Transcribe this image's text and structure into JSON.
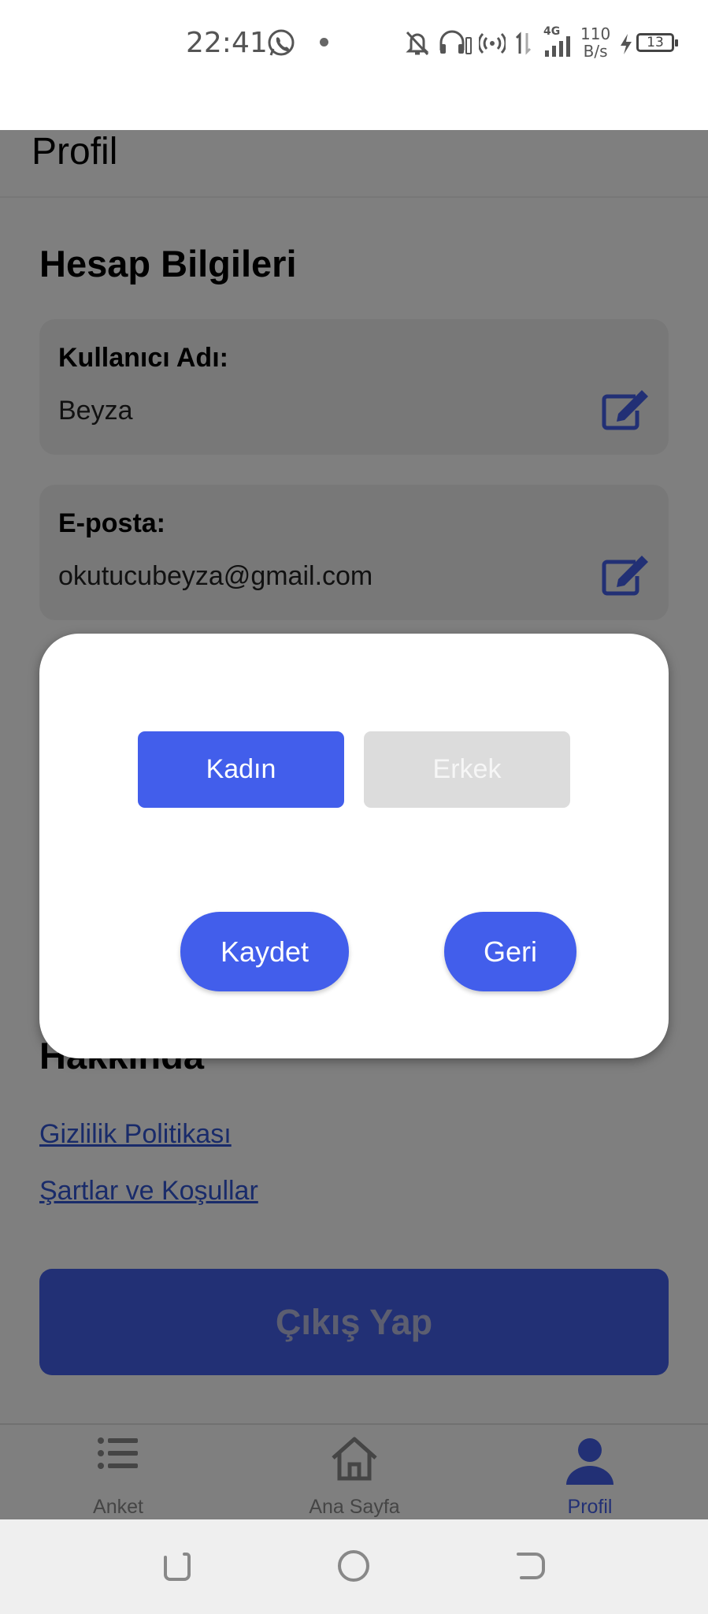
{
  "status_bar": {
    "time": "22:41",
    "network_type": "4G",
    "speed_value": "110",
    "speed_unit": "B/s",
    "battery": "13",
    "icons": [
      "whatsapp-icon",
      "notification-dot",
      "bell-off-icon",
      "headphones-icon",
      "hotspot-icon",
      "data-arrows-icon",
      "signal-icon",
      "charging-icon",
      "battery-icon"
    ]
  },
  "header": {
    "title": "Profil"
  },
  "account": {
    "title": "Hesap Bilgileri",
    "fields": [
      {
        "label": "Kullanıcı Adı:",
        "value": "Beyza",
        "icon": "edit-icon"
      },
      {
        "label": "E-posta:",
        "value": "okutucubeyza@gmail.com",
        "icon": "edit-icon"
      }
    ]
  },
  "about": {
    "title": "Hakkında",
    "links": [
      "Gizlilik Politikası",
      "Şartlar ve Koşullar"
    ]
  },
  "logout_label": "Çıkış Yap",
  "tabs": [
    {
      "label": "Anket",
      "icon": "list-icon",
      "active": false
    },
    {
      "label": "Ana Sayfa",
      "icon": "home-icon",
      "active": false
    },
    {
      "label": "Profil",
      "icon": "user-icon",
      "active": true
    }
  ],
  "modal": {
    "options": [
      {
        "label": "Kadın",
        "selected": true
      },
      {
        "label": "Erkek",
        "selected": false
      }
    ],
    "save_label": "Kaydet",
    "back_label": "Geri"
  },
  "system_nav": [
    "recents-icon",
    "home-circle-icon",
    "back-icon"
  ],
  "colors": {
    "accent": "#425EEB",
    "link": "#3357D4",
    "card_bg": "#F1F1F1",
    "unselected_option": "#DCDCDC",
    "overlay": "rgba(0,0,0,0.5)"
  }
}
